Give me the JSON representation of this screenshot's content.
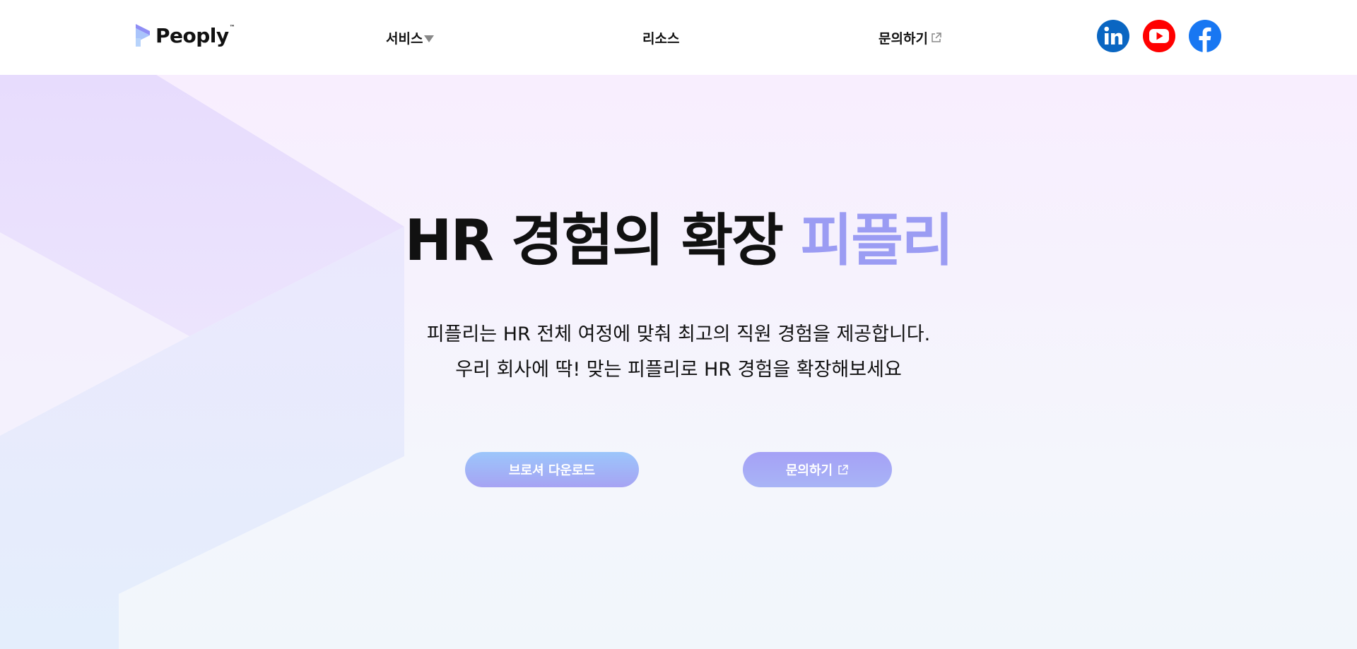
{
  "header": {
    "logo_text": "Peoply",
    "logo_tm": "™",
    "nav": {
      "service": "서비스",
      "resource": "리소스",
      "contact": "문의하기"
    },
    "social": [
      "linkedin-icon",
      "youtube-icon",
      "facebook-icon"
    ]
  },
  "hero": {
    "title_main": "HR 경험의 확장",
    "title_accent": "피플리",
    "subtitle_line1": "피플리는 HR 전체 여정에 맞춰 최고의 직원 경험을 제공합니다.",
    "subtitle_line2": "우리 회사에 딱! 맞는 피플리로 HR 경험을 확장해보세요",
    "brochure_button": "브로셔 다운로드",
    "contact_button": "문의하기"
  },
  "colors": {
    "accent": "#9b9cf3",
    "text": "#111111",
    "linkedin": "#0a66c2",
    "youtube": "#ff0000",
    "facebook": "#1877f2"
  }
}
